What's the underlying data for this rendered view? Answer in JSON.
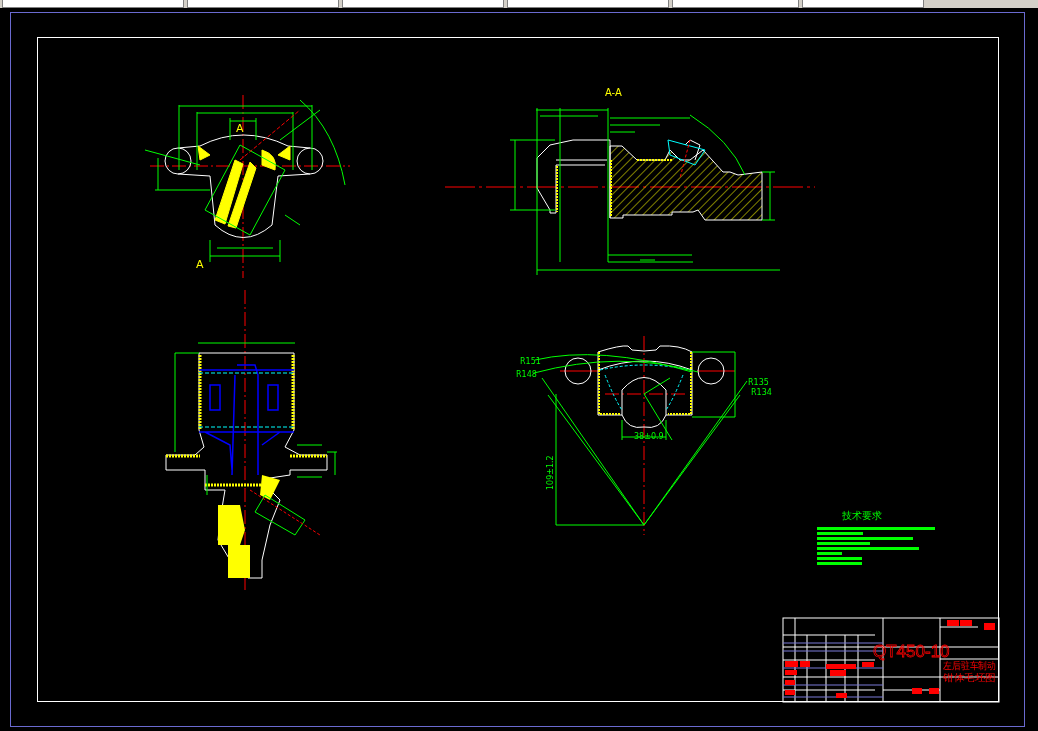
{
  "drawing": {
    "views": [
      {
        "kind": "front",
        "labels": [
          "A",
          "A"
        ]
      },
      {
        "kind": "section",
        "labels": [
          "A-A"
        ]
      },
      {
        "kind": "bottom"
      },
      {
        "kind": "arc",
        "labels": [
          "R151",
          "R148",
          "R135",
          "R134",
          "109±1.2",
          "38±0.9"
        ]
      }
    ],
    "technical_requirements": {
      "title": "技术要求"
    },
    "title_block": {
      "material": "QT450-10",
      "part_name": [
        "左后驻车制动",
        "钳体毛坯图"
      ]
    }
  }
}
